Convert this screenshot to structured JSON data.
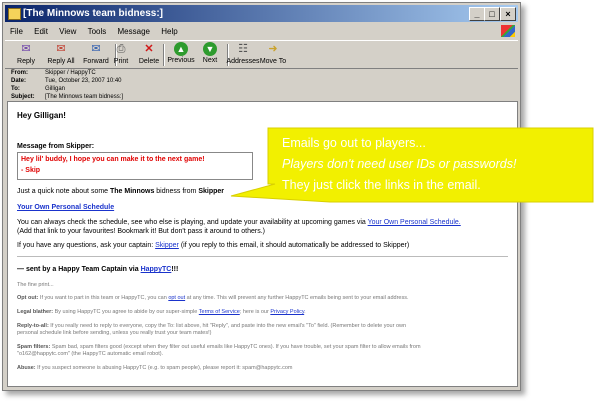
{
  "window": {
    "title": "[The Minnows team bidness:]",
    "controls": {
      "minimize": "_",
      "maximize": "□",
      "close": "×"
    }
  },
  "menu": [
    "File",
    "Edit",
    "View",
    "Tools",
    "Message",
    "Help"
  ],
  "toolbar": [
    {
      "label": "Reply",
      "icon": "reply-icon",
      "glyph": "✉"
    },
    {
      "label": "Reply All",
      "icon": "reply-all-icon",
      "glyph": "✉"
    },
    {
      "label": "Forward",
      "icon": "forward-icon",
      "glyph": "✉"
    },
    {
      "label": "Print",
      "icon": "print-icon",
      "glyph": "⎙"
    },
    {
      "label": "Delete",
      "icon": "delete-icon",
      "glyph": "✕"
    },
    {
      "label": "Previous",
      "icon": "previous-icon",
      "glyph": "▲"
    },
    {
      "label": "Next",
      "icon": "next-icon",
      "glyph": "▼"
    },
    {
      "label": "Addresses",
      "icon": "addresses-icon",
      "glyph": "☷"
    },
    {
      "label": "Move To",
      "icon": "move-to-icon",
      "glyph": "➜"
    }
  ],
  "headers": {
    "from_label": "From:",
    "from": "Skipper / HappyTC",
    "date_label": "Date:",
    "date": "Tue, October 23, 2007 10:40",
    "to_label": "To:",
    "to": "Gilligan",
    "subject_label": "Subject:",
    "subject": "[The Minnows team bidness:]"
  },
  "email": {
    "greeting": "Hey Gilligan!",
    "msg_title": "Message from Skipper:",
    "msg_line1": "Hey lil' buddy, I hope you can make it to the next game!",
    "msg_line2": "- Skip",
    "note_prefix": "Just a quick note about some ",
    "note_team": "The Minnows",
    "note_mid": " bidness from ",
    "note_sender": "Skipper",
    "schedule_link": "Your Own Personal Schedule",
    "check_text": "You can always check the schedule, see who else is playing, and update your availability at upcoming games via ",
    "check_link": "Your Own Personal Schedule.",
    "check_text2": "(Add that link to your favourites! Bookmark it! But don't pass it around to others.)",
    "questions_text": "If you have any questions, ask your captain: ",
    "questions_link": "Skipper",
    "questions_text2": " (if you reply to this email, it should automatically be addressed to Skipper)",
    "sent_prefix": "— sent by a Happy Team Captain via ",
    "sent_link": "HappyTC",
    "sent_suffix": "!!!",
    "fine_title": "The fine print...",
    "optout_label": "Opt out:",
    "optout_text": " If you want to part in this team or HappyTC, you can ",
    "optout_link": "opt out",
    "optout_text2": " at any time. This will prevent any further HappyTC emails being sent to your email address.",
    "legal_label": "Legal blather:",
    "legal_text": " By using HappyTC you agree to abide by our super-simple ",
    "legal_link": "Terms of Service",
    "legal_text2": "; here is our ",
    "legal_link2": "Privacy Policy",
    "legal_text3": ".",
    "replyall_label": "Reply-to-all:",
    "replyall_text": " If you really need to reply to everyone, copy the To: list above, hit \"Reply\", and paste into the new email's \"To\" field. (Remember to delete your own",
    "replyall_text2": "personal schedule link before sending, unless you really trust your team mates!)",
    "spam_label": "Spam filters:",
    "spam_text": " Spam bad, spam filters good (except when they filter out useful emails like HappyTC ones). If you have trouble, set your spam filter to allow emails from",
    "spam_text2": "\"o162@happytc.com\" (the HappyTC automatic email robot).",
    "abuse_label": "Abuse:",
    "abuse_text": " If you suspect someone is abusing HappyTC (e.g. to spam people), please report it: spam@happytc.com"
  },
  "callout": {
    "line1": "Emails go out to players...",
    "line2": "Players don't need user IDs or passwords!",
    "line3": "They just click the links in the email.",
    "fill_color": "#f2f000",
    "text_color": "#ffffff"
  }
}
